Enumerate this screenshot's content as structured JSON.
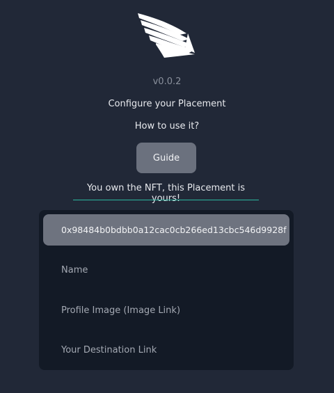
{
  "app": {
    "version": "v0.0.2",
    "configure_title": "Configure your Placement",
    "how_to_label": "How to use it?",
    "guide_label": "Guide",
    "ownership_message": "You own the NFT, this Placement is yours!"
  },
  "placement": {
    "address": "0x98484b0bdbb0a12cac0cb266ed13cbc546d9928f",
    "fields": {
      "name_placeholder": "Name",
      "profile_image_placeholder": "Profile Image (Image Link)",
      "destination_placeholder": "Your Destination Link"
    }
  },
  "icons": {
    "logo": "wing-logo-icon"
  },
  "colors": {
    "background": "#212837",
    "card": "#131a26",
    "button": "#6b717e",
    "accent_underline": "#2bb8a0"
  }
}
